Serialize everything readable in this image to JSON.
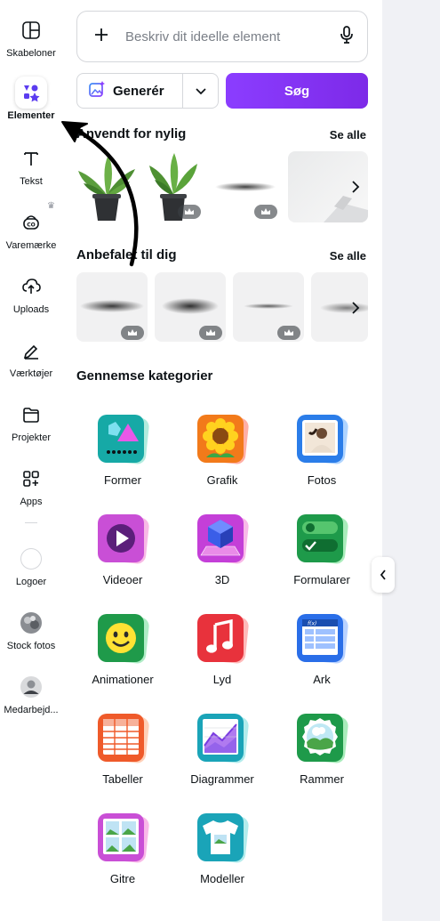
{
  "rail": {
    "items": [
      {
        "label": "Skabeloner",
        "icon": "templates-icon"
      },
      {
        "label": "Elementer",
        "icon": "elements-icon",
        "active": true
      },
      {
        "label": "Tekst",
        "icon": "text-icon"
      },
      {
        "label": "Varemærke",
        "icon": "brand-icon"
      },
      {
        "label": "Uploads",
        "icon": "upload-icon"
      },
      {
        "label": "Værktøjer",
        "icon": "tools-icon"
      },
      {
        "label": "Projekter",
        "icon": "folder-icon"
      },
      {
        "label": "Apps",
        "icon": "apps-icon"
      },
      {
        "label": "Logoer",
        "icon": "logo-icon"
      },
      {
        "label": "Stock fotos",
        "icon": "stock-photo-icon"
      },
      {
        "label": "Medarbejd...",
        "icon": "avatar-icon"
      }
    ]
  },
  "search": {
    "placeholder": "Beskriv dit ideelle element"
  },
  "actions": {
    "generate_label": "Generér",
    "search_label": "Søg"
  },
  "sections": {
    "recent": {
      "title": "Anvendt for nylig",
      "see_all": "Se alle"
    },
    "recommended": {
      "title": "Anbefalet til dig",
      "see_all": "Se alle"
    },
    "browse": {
      "title": "Gennemse kategorier"
    }
  },
  "categories": [
    {
      "label": "Former"
    },
    {
      "label": "Grafik"
    },
    {
      "label": "Fotos"
    },
    {
      "label": "Videoer"
    },
    {
      "label": "3D"
    },
    {
      "label": "Formularer"
    },
    {
      "label": "Animationer"
    },
    {
      "label": "Lyd"
    },
    {
      "label": "Ark"
    },
    {
      "label": "Tabeller"
    },
    {
      "label": "Diagrammer"
    },
    {
      "label": "Rammer"
    },
    {
      "label": "Gitre"
    },
    {
      "label": "Modeller"
    }
  ],
  "colors": {
    "accent": "#8b3dff",
    "text": "#0d1216",
    "border": "#d5d7db"
  }
}
